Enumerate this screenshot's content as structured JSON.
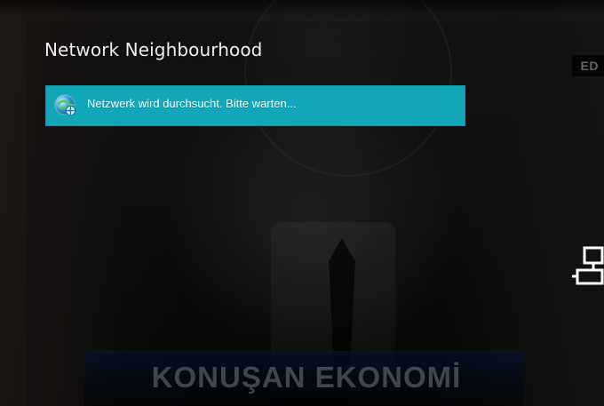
{
  "dialog": {
    "title": "Network Neighbourhood",
    "status_message": "Netzwerk wird durchsucht. Bitte warten...",
    "status_icon": "globe-network-icon",
    "status_color": "#12a6b9"
  },
  "background": {
    "corner_tag_text": "ED",
    "lower_third_text": "KONUŞAN EKONOMİ"
  },
  "right_edge": {
    "icon": "network-icon"
  }
}
